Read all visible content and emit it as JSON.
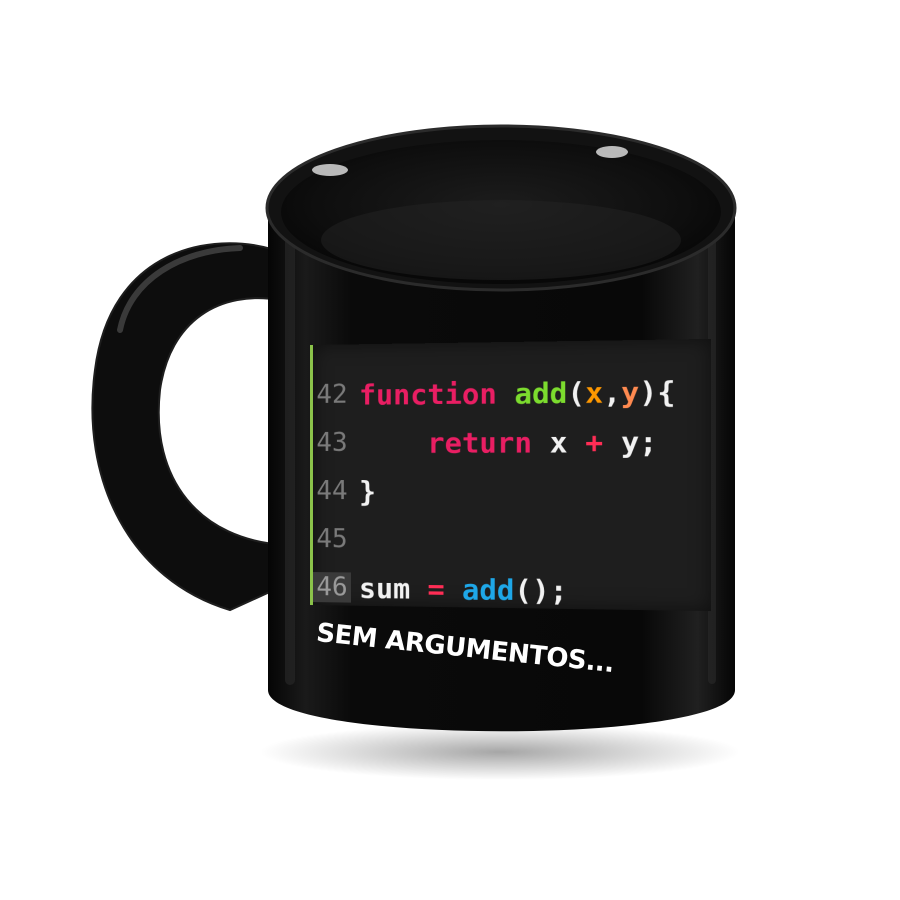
{
  "product": {
    "type": "mug",
    "mug_color": "#0b0b0b",
    "background_color": "#ffffff"
  },
  "code_snippet": {
    "colors": {
      "panel_bg": "#1e1e1e",
      "gutter_border": "#8bc34a",
      "keyword": "#e91e63",
      "function_name": "#7cdc2e",
      "param_x": "#ff9800",
      "param_y": "#ff8a50",
      "operator": "#ff2d55",
      "call": "#1ea7e8",
      "plain": "#f2f2f2"
    },
    "lines": [
      {
        "num": "42",
        "tokens": [
          {
            "text": "function ",
            "role": "keyword"
          },
          {
            "text": "add",
            "role": "function_name"
          },
          {
            "text": "(",
            "role": "plain"
          },
          {
            "text": "x",
            "role": "param_x"
          },
          {
            "text": ",",
            "role": "plain"
          },
          {
            "text": "y",
            "role": "param_y"
          },
          {
            "text": "){",
            "role": "plain"
          }
        ]
      },
      {
        "num": "43",
        "tokens": [
          {
            "text": "    return ",
            "role": "keyword"
          },
          {
            "text": "x ",
            "role": "plain"
          },
          {
            "text": "+ ",
            "role": "operator"
          },
          {
            "text": "y;",
            "role": "plain"
          }
        ]
      },
      {
        "num": "44",
        "tokens": [
          {
            "text": "}",
            "role": "plain"
          }
        ]
      },
      {
        "num": "45",
        "tokens": []
      },
      {
        "num": "46",
        "active": true,
        "tokens": [
          {
            "text": "sum ",
            "role": "plain"
          },
          {
            "text": "= ",
            "role": "operator"
          },
          {
            "text": "add",
            "role": "call"
          },
          {
            "text": "();",
            "role": "plain"
          }
        ]
      }
    ]
  },
  "caption": {
    "text": "SEM ARGUMENTOS...",
    "color": "#ffffff"
  }
}
